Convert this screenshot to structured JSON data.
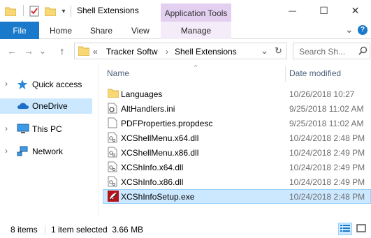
{
  "window": {
    "title": "Shell Extensions",
    "context_tab_group": "Application Tools",
    "minimize_glyph": "—",
    "maximize_glyph": "☐",
    "close_glyph": "✕"
  },
  "ribbon": {
    "file_tab": "File",
    "tabs": [
      "Home",
      "Share",
      "View"
    ],
    "context_tab": "Manage",
    "expand_glyph": "⌄",
    "help_glyph": "?"
  },
  "address": {
    "back_glyph": "←",
    "forward_glyph": "→",
    "recent_glyph": "⌄",
    "up_glyph": "↑",
    "overflow": "«",
    "crumbs": [
      "Tracker Softw",
      "Shell Extensions"
    ],
    "crumb_sep": "›",
    "dropdown_glyph": "⌄",
    "refresh_glyph": "↻",
    "search_placeholder": "Search Sh..."
  },
  "nav": {
    "items": [
      {
        "label": "Quick access",
        "icon": "star-icon",
        "selected": false
      },
      {
        "label": "OneDrive",
        "icon": "cloud-icon",
        "selected": true
      },
      {
        "label": "This PC",
        "icon": "computer-icon",
        "selected": false
      },
      {
        "label": "Network",
        "icon": "network-icon",
        "selected": false
      }
    ],
    "chevron": "›"
  },
  "columns": {
    "name": "Name",
    "date": "Date modified",
    "sort_glyph": "^"
  },
  "files": [
    {
      "name": "Languages",
      "date": "10/26/2018 10:27",
      "icon": "folder-icon"
    },
    {
      "name": "AltHandlers.ini",
      "date": "9/25/2018 11:02 AM",
      "icon": "settings-file-icon"
    },
    {
      "name": "PDFProperties.propdesc",
      "date": "9/25/2018 11:02 AM",
      "icon": "document-icon"
    },
    {
      "name": "XCShellMenu.x64.dll",
      "date": "10/24/2018 2:48 PM",
      "icon": "dll-icon"
    },
    {
      "name": "XCShellMenu.x86.dll",
      "date": "10/24/2018 2:49 PM",
      "icon": "dll-icon"
    },
    {
      "name": "XCShInfo.x64.dll",
      "date": "10/24/2018 2:49 PM",
      "icon": "dll-icon"
    },
    {
      "name": "XCShInfo.x86.dll",
      "date": "10/24/2018 2:49 PM",
      "icon": "dll-icon"
    },
    {
      "name": "XCShInfoSetup.exe",
      "date": "10/24/2018 2:48 PM",
      "icon": "exe-icon",
      "selected": true
    }
  ],
  "status": {
    "count": "8 items",
    "selection": "1 item selected  3.66 MB"
  },
  "colors": {
    "accent": "#1979ca",
    "selection": "#cce8ff",
    "context_tab": "#e3cff0",
    "folder": "#f8d775"
  }
}
